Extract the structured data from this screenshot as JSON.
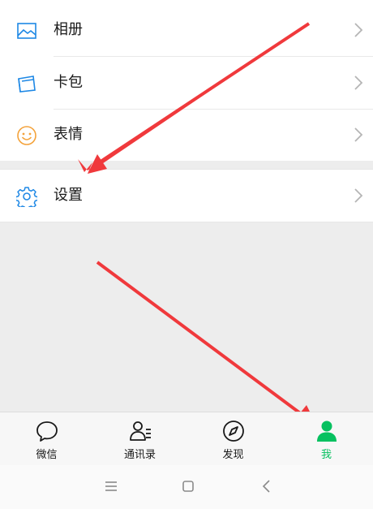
{
  "menu": [
    {
      "id": "album",
      "label": "相册",
      "icon": "photo-icon"
    },
    {
      "id": "cards",
      "label": "卡包",
      "icon": "card-wallet-icon"
    },
    {
      "id": "stickers",
      "label": "表情",
      "icon": "smiley-icon"
    }
  ],
  "settings": {
    "label": "设置",
    "icon": "gear-icon"
  },
  "tabs": [
    {
      "label": "微信",
      "icon": "chat-bubble-icon",
      "active": false
    },
    {
      "label": "通讯录",
      "icon": "contacts-icon",
      "active": false
    },
    {
      "label": "发现",
      "icon": "compass-icon",
      "active": false
    },
    {
      "label": "我",
      "icon": "person-icon",
      "active": true
    }
  ],
  "colors": {
    "accent_green": "#07c160",
    "icon_blue": "#1e88e5",
    "icon_orange": "#f4a23a",
    "arrow_red": "#f0393c"
  }
}
